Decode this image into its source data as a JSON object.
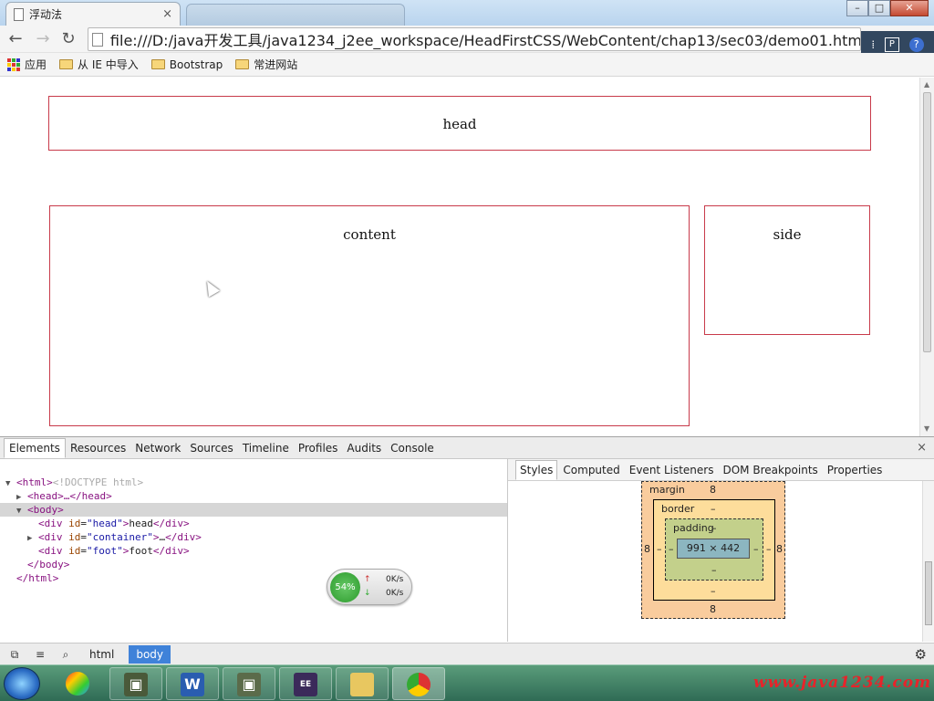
{
  "browser": {
    "active_tab_title": "浮动法",
    "tab_close": "×",
    "url": "file:///D:/java开发工具/java1234_j2ee_workspace/HeadFirstCSS/WebContent/chap13/sec03/demo01.html",
    "bookmarks": [
      {
        "label": "应用",
        "icon": "apps-icon"
      },
      {
        "label": "从 IE 中导入",
        "icon": "folder-icon"
      },
      {
        "label": "Bootstrap",
        "icon": "folder-icon"
      },
      {
        "label": "常进网站",
        "icon": "folder-icon"
      }
    ],
    "extensions": {
      "p": "P",
      "help": "?"
    }
  },
  "page": {
    "head": "head",
    "content": "content",
    "side": "side"
  },
  "devtools": {
    "tabs": [
      "Elements",
      "Resources",
      "Network",
      "Sources",
      "Timeline",
      "Profiles",
      "Audits",
      "Console"
    ],
    "close": "×",
    "dom": {
      "doctype": "<!DOCTYPE html>",
      "html_open": "<html>",
      "head_collapsed": "<head>…</head>",
      "body_open": "<body>",
      "div_head_tag": "div",
      "div_head_attr": "id",
      "div_head_val": "\"head\"",
      "div_head_text": "head",
      "div_container_val": "\"container\"",
      "div_container_text": "…",
      "div_foot_val": "\"foot\"",
      "div_foot_text": "foot",
      "body_close": "</body>",
      "html_close": "</html>"
    },
    "net_widget": {
      "percent": "54%",
      "up": "0K/s",
      "down": "0K/s"
    },
    "sidebar_tabs": [
      "Styles",
      "Computed",
      "Event Listeners",
      "DOM Breakpoints",
      "Properties"
    ],
    "box_model": {
      "margin_label": "margin",
      "margin_top": "8",
      "margin_bottom": "8",
      "margin_left": "8",
      "margin_right": "8",
      "border_label": "border",
      "border_top": "–",
      "border_bottom": "–",
      "border_left": "–",
      "border_right": "–",
      "padding_label": "padding",
      "padding_top": "–",
      "padding_bottom": "–",
      "padding_left": "–",
      "padding_right": "–",
      "content_size": "991 × 442"
    },
    "breadcrumbs": [
      "html",
      "body"
    ]
  },
  "taskbar": {
    "watermark": "www.java1234.com"
  },
  "colors": {
    "box_border": "#c83a4a",
    "crumb_active": "#3f82d9"
  }
}
